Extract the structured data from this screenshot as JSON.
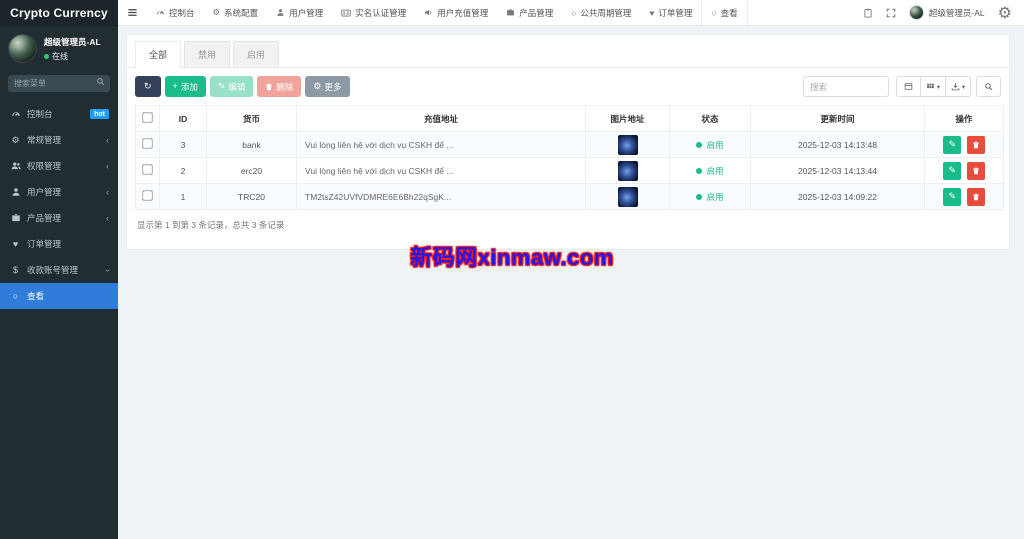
{
  "colors": {
    "sidebar_bg": "#222d32",
    "sidebar_active_blue": "#2f7cdb",
    "badge_blue": "#1e9fff",
    "accent_green": "#1abc8c",
    "accent_red": "#e74c3c",
    "refresh_navy": "#35405a",
    "more_gray": "#8d99a5",
    "status_green": "#1cbc8c",
    "page_bg": "#f0f3f6",
    "watermark_blue": "#2218f0",
    "watermark_red": "#ff1100"
  },
  "sidebar": {
    "brand": "Crypto Currency",
    "user": {
      "name": "超级管理员-AL",
      "status": "在线"
    },
    "search_placeholder": "搜索菜单",
    "items": [
      {
        "label": "控制台",
        "icon": "gauge-icon",
        "badge": "hot"
      },
      {
        "label": "常规管理",
        "icon": "gears-icon",
        "chevron": "left"
      },
      {
        "label": "权限管理",
        "icon": "users-icon",
        "chevron": "left"
      },
      {
        "label": "用户管理",
        "icon": "user-icon",
        "chevron": "left"
      },
      {
        "label": "产品管理",
        "icon": "product-icon",
        "chevron": "left"
      },
      {
        "label": "订单管理",
        "icon": "heart-icon"
      },
      {
        "label": "收款账号管理",
        "icon": "money-icon",
        "chevron": "down",
        "expanded": true
      },
      {
        "label": "查看",
        "icon": "circle-icon",
        "active": true
      }
    ]
  },
  "topnav": {
    "tabs": [
      {
        "label": "控制台",
        "icon": "gauge-icon"
      },
      {
        "label": "系统配置",
        "icon": "gear-icon"
      },
      {
        "label": "用户管理",
        "icon": "user-icon"
      },
      {
        "label": "实名认证管理",
        "icon": "id-card-icon"
      },
      {
        "label": "用户充值管理",
        "icon": "volume-icon"
      },
      {
        "label": "产品管理",
        "icon": "briefcase-icon"
      },
      {
        "label": "公共周期管理",
        "icon": "circle-icon"
      },
      {
        "label": "订单管理",
        "icon": "heart-icon"
      },
      {
        "label": "查看",
        "icon": "circle-icon",
        "active": true
      }
    ],
    "right_icons": [
      "clipboard-icon",
      "fullscreen-icon",
      "gears-icon"
    ],
    "user_name": "超级管理员-AL"
  },
  "panel": {
    "tabs": [
      {
        "label": "全部",
        "active": true
      },
      {
        "label": "禁用"
      },
      {
        "label": "启用"
      }
    ],
    "toolbar": {
      "add": "添加",
      "edit": "编辑",
      "delete": "删除",
      "more": "更多",
      "search_placeholder": "搜索"
    },
    "table": {
      "columns": [
        "ID",
        "货币",
        "充值地址",
        "图片地址",
        "状态",
        "更新时间",
        "操作"
      ],
      "rows": [
        {
          "id": "3",
          "currency": "bank",
          "address": "Vui lòng liên hệ với dịch vụ CSKH để ...",
          "status": "启用",
          "updated": "2025-12-03 14:13:48"
        },
        {
          "id": "2",
          "currency": "erc20",
          "address": "Vui lòng liên hệ với dịch vụ CSKH để ...",
          "status": "启用",
          "updated": "2025-12-03 14:13:44"
        },
        {
          "id": "1",
          "currency": "TRC20",
          "address": "TM2tsZ42UVfVDMRE6E6Bh22qSgK...",
          "status": "启用",
          "updated": "2025-12-03 14:09:22"
        }
      ]
    },
    "footer_summary": "显示第 1 到第 3 条记录，总共 3 条记录"
  },
  "watermark": "新码网xinmaw.com"
}
